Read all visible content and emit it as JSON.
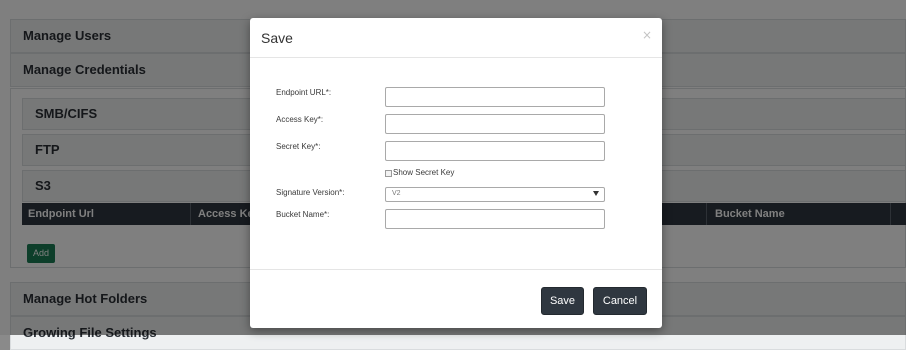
{
  "page": {
    "sections": {
      "manage_users": "Manage Users",
      "manage_credentials": "Manage Credentials",
      "manage_hot_folders": "Manage Hot Folders",
      "growing_file_settings": "Growing File Settings"
    },
    "credentials": {
      "smb_cifs": "SMB/CIFS",
      "ftp": "FTP",
      "s3": "S3",
      "columns": [
        "Endpoint Url",
        "Access Key",
        "Bucket Name"
      ],
      "add_label": "Add"
    }
  },
  "modal": {
    "title": "Save",
    "close_glyph": "×",
    "fields": {
      "endpoint_url": {
        "label": "Endpoint URL*:",
        "value": ""
      },
      "access_key": {
        "label": "Access Key*:",
        "value": ""
      },
      "secret_key": {
        "label": "Secret Key*:",
        "value": ""
      },
      "show_secret_key": {
        "label": "Show Secret Key",
        "checked": false
      },
      "signature_version": {
        "label": "Signature Version*:",
        "selected": "V2"
      },
      "bucket_name": {
        "label": "Bucket Name*:",
        "value": ""
      }
    },
    "buttons": {
      "save": "Save",
      "cancel": "Cancel"
    }
  },
  "colors": {
    "overlay": "#000000",
    "dark_button": "#2f3740",
    "add_button": "#1a7d55",
    "table_header": "#2f3740"
  }
}
